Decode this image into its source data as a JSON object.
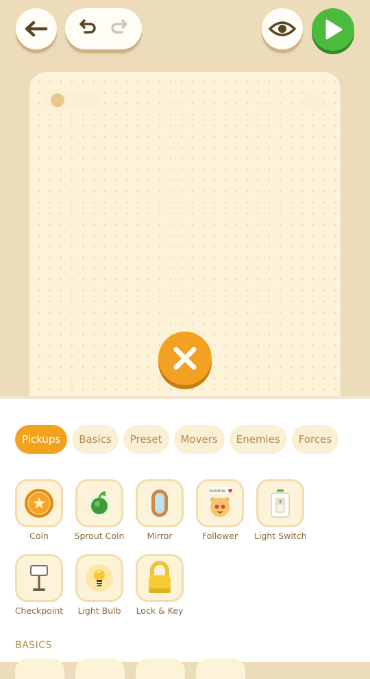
{
  "toolbar": {
    "back": "back-arrow",
    "undo": "undo-arrow",
    "redo": "redo-arrow",
    "preview": "eye",
    "play": "play-triangle",
    "colors": {
      "play": "#4cba3c",
      "accent": "#f4a21e"
    }
  },
  "tabs": [
    "Pickups",
    "Basics",
    "Preset",
    "Movers",
    "Enemies",
    "Forces"
  ],
  "active_tab": "Pickups",
  "items": [
    {
      "label": "Coin",
      "icon": "coin-icon"
    },
    {
      "label": "Sprout Coin",
      "icon": "sprout-coin-icon"
    },
    {
      "label": "Mirror",
      "icon": "mirror-icon"
    },
    {
      "label": "Follower",
      "icon": "follower-icon",
      "badge": "Goldilie"
    },
    {
      "label": "Light Switch",
      "icon": "light-switch-icon"
    },
    {
      "label": "Checkpoint",
      "icon": "checkpoint-icon"
    },
    {
      "label": "Light Bulb",
      "icon": "light-bulb-icon"
    },
    {
      "label": "Lock & Key",
      "icon": "lock-icon"
    }
  ],
  "next_section": "BASICS"
}
